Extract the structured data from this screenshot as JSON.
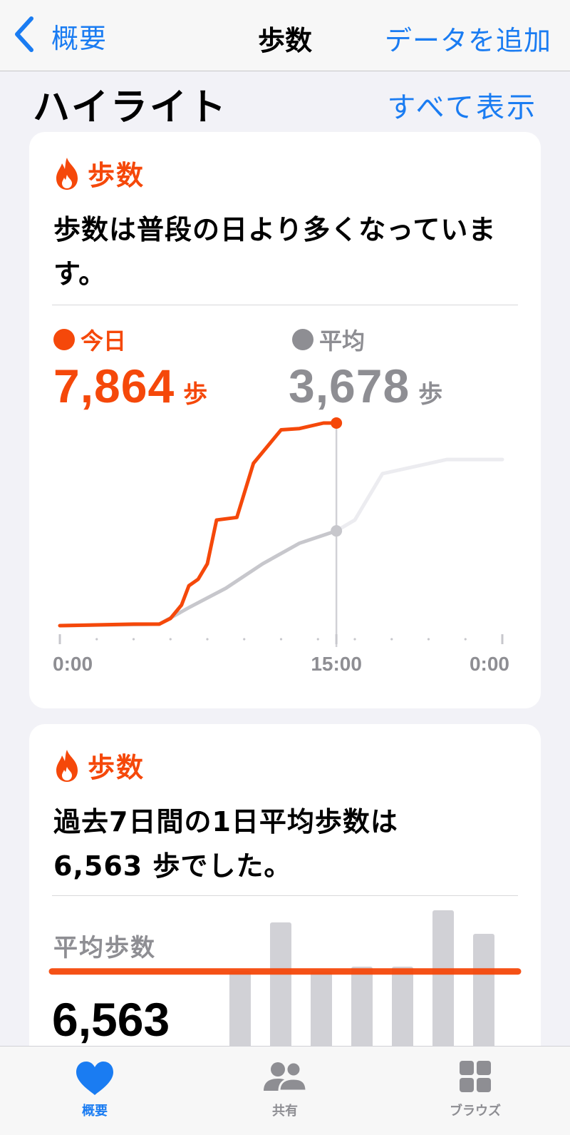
{
  "nav": {
    "back_label": "概要",
    "title": "歩数",
    "add_data": "データを追加"
  },
  "section": {
    "title": "ハイライト",
    "show_all": "すべて表示"
  },
  "highlight1": {
    "category": "歩数",
    "message": "歩数は普段の日より多くなっています。",
    "legend_today": "今日",
    "legend_avg": "平均",
    "today_value": "7,864",
    "avg_value": "3,678",
    "unit": "歩"
  },
  "highlight2": {
    "category": "歩数",
    "message_line1": "過去7日間の1日平均歩数は",
    "message_line2": "6,563 歩でした。",
    "avg_label": "平均歩数",
    "avg_value": "6,563"
  },
  "chart_data": [
    {
      "type": "line",
      "x_tick_labels": [
        "0:00",
        "15:00",
        "0:00"
      ],
      "current_time": "15:00",
      "series": [
        {
          "name": "今日",
          "color": "#f5480a",
          "x_hours": [
            0,
            4,
            5.4,
            6,
            6.6,
            7,
            7.5,
            8,
            8.5,
            9.6,
            10.5,
            12,
            13,
            14.3,
            15
          ],
          "y_steps": [
            0,
            60,
            60,
            280,
            800,
            1550,
            1800,
            2400,
            4100,
            4200,
            6300,
            7600,
            7650,
            7864,
            7864
          ]
        },
        {
          "name": "平均",
          "color": "#c7c7cc",
          "x_hours": [
            0,
            5.4,
            7,
            9,
            11,
            13,
            15,
            16,
            17.5,
            21,
            24
          ],
          "y_steps": [
            0,
            60,
            700,
            1450,
            2400,
            3200,
            3678,
            4100,
            5900,
            6450,
            6450
          ]
        }
      ]
    },
    {
      "type": "bar",
      "title": "平均歩数",
      "days": 7,
      "values": [
        6600,
        10000,
        6550,
        6900,
        6900,
        10850,
        9200
      ],
      "average": 6563
    }
  ],
  "tabs": {
    "summary": "概要",
    "sharing": "共有",
    "browse": "ブラウズ"
  },
  "colors": {
    "accent": "#1a7cf2",
    "steps_orange": "#f5480a",
    "gray": "#8e8e93"
  }
}
